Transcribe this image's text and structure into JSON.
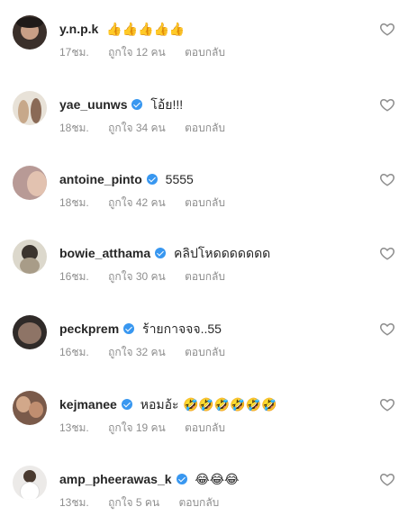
{
  "comments": [
    {
      "username": "y.n.p.k",
      "verified": false,
      "text": "👍👍👍👍👍",
      "time": "17ชม.",
      "likes": "ถูกใจ 12 คน",
      "reply": "ตอบกลับ",
      "avatar_color": "#3a2f2a"
    },
    {
      "username": "yae_uunws",
      "verified": true,
      "text": "โอ้ย!!!",
      "time": "18ชม.",
      "likes": "ถูกใจ 34 คน",
      "reply": "ตอบกลับ",
      "avatar_color": "#c9b9a8"
    },
    {
      "username": "antoine_pinto",
      "verified": true,
      "text": "5555",
      "time": "18ชม.",
      "likes": "ถูกใจ 42 คน",
      "reply": "ตอบกลับ",
      "avatar_color": "#b89a96"
    },
    {
      "username": "bowie_atthama",
      "verified": true,
      "text": "คลิปโหดดดดดดด",
      "time": "16ชม.",
      "likes": "ถูกใจ 30 คน",
      "reply": "ตอบกลับ",
      "avatar_color": "#d8d4c8"
    },
    {
      "username": "peckprem",
      "verified": true,
      "text": "ร้ายกาจจจ..55",
      "time": "16ชม.",
      "likes": "ถูกใจ 32 คน",
      "reply": "ตอบกลับ",
      "avatar_color": "#4a4240"
    },
    {
      "username": "kejmanee",
      "verified": true,
      "text": "หอมอ้ะ 🤣🤣🤣🤣🤣🤣",
      "time": "13ชม.",
      "likes": "ถูกใจ 19 คน",
      "reply": "ตอบกลับ",
      "avatar_color": "#7a5a4a"
    },
    {
      "username": "amp_pheerawas_k",
      "verified": true,
      "text": "😂😂😂",
      "time": "13ชม.",
      "likes": "ถูกใจ 5 คน",
      "reply": "ตอบกลับ",
      "avatar_color": "#e4e2e0"
    }
  ],
  "icons": {
    "like": "heart-outline-icon",
    "verified": "verified-badge-icon"
  },
  "colors": {
    "username": "#262626",
    "meta": "#8e8e8e",
    "verified": "#3897f0"
  }
}
